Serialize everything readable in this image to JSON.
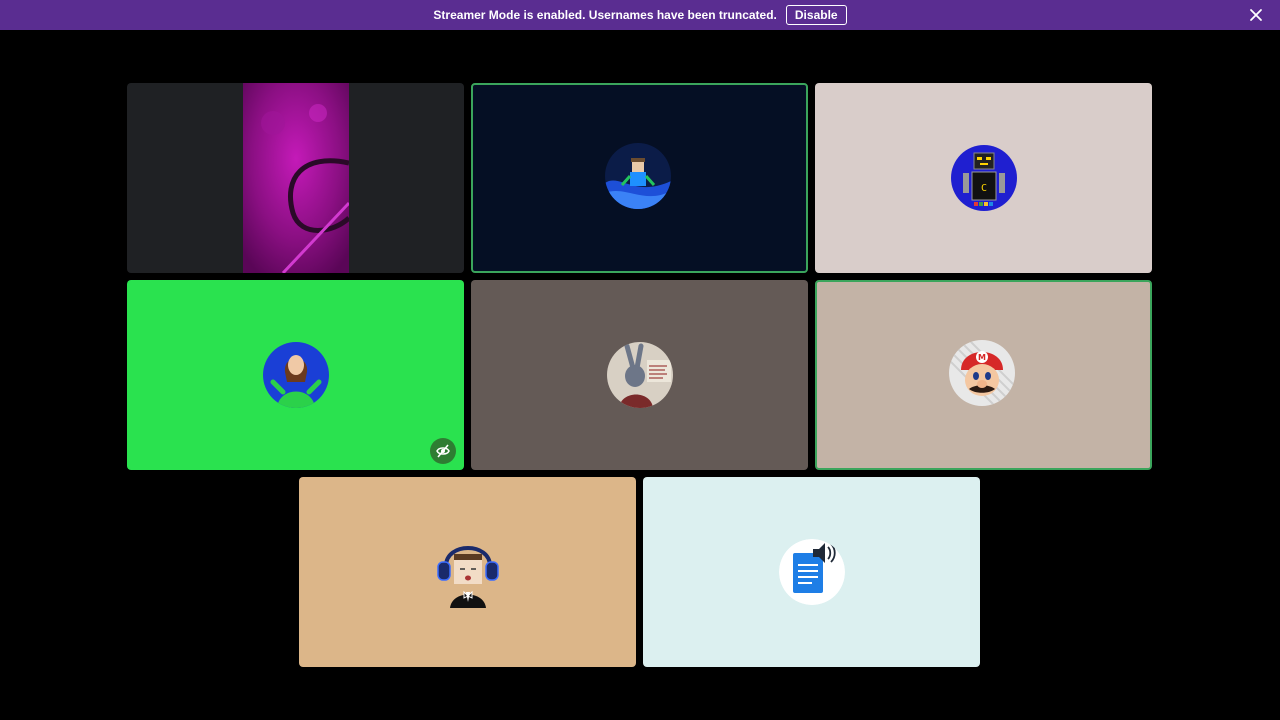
{
  "banner": {
    "message": "Streamer Mode is enabled. Usernames have been truncated.",
    "disable_label": "Disable",
    "close_icon": "close-icon",
    "background": "#5a2d91"
  },
  "tiles": [
    {
      "kind": "camera-feed",
      "background": "#1f2124",
      "speaking": false
    },
    {
      "avatar": "astronaut-avatar",
      "background": "#050f24",
      "speaking": true
    },
    {
      "avatar": "robot-avatar",
      "background": "#d9cdca",
      "speaking": false
    },
    {
      "avatar": "woman-avatar",
      "background": "#2ae24f",
      "speaking": false,
      "badge": "eye-off-icon"
    },
    {
      "avatar": "rabbit-avatar",
      "background": "#645a56",
      "speaking": false
    },
    {
      "avatar": "mario-avatar",
      "background": "#c3b3a6",
      "speaking": true
    },
    {
      "avatar": "headphones-avatar",
      "background": "#dcb689",
      "speaking": false
    },
    {
      "avatar": "document-speaker-avatar",
      "background": "#dcf0f0",
      "speaking": false
    }
  ],
  "colors": {
    "accent_speaking": "#3ba55c",
    "page_background": "#000000"
  }
}
